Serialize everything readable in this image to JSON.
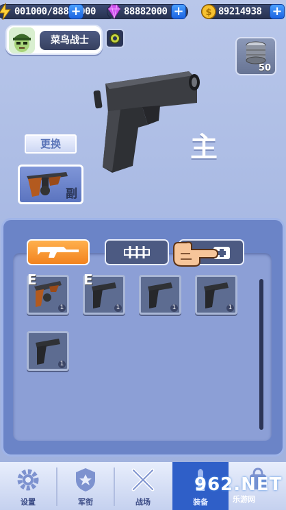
{
  "resources": {
    "energy": "001000/88887000",
    "gems": "88882000",
    "coins": "89214938"
  },
  "player": {
    "name": "菜鸟战士"
  },
  "ammo": {
    "count": "50"
  },
  "main_weapon": {
    "label": "主"
  },
  "swap_button": "更换",
  "secondary_weapon": {
    "tag": "副"
  },
  "inventory": {
    "tabs": [
      {
        "name": "rifle",
        "active": true
      },
      {
        "name": "ammo-belt",
        "active": false
      },
      {
        "name": "medkit",
        "active": false
      }
    ],
    "items": [
      {
        "kind": "tommy-gun",
        "qty": "1",
        "equipped_mark": "E"
      },
      {
        "kind": "pistol",
        "qty": "1",
        "equipped_mark": "E"
      },
      {
        "kind": "pistol",
        "qty": "1",
        "equipped_mark": ""
      },
      {
        "kind": "pistol",
        "qty": "1",
        "equipped_mark": ""
      },
      {
        "kind": "pistol",
        "qty": "1",
        "equipped_mark": ""
      }
    ]
  },
  "nav": {
    "settings": "设置",
    "rank": "军衔",
    "battle": "战场",
    "armory": "装备",
    "extra": ""
  },
  "watermark": {
    "main": "962.NET",
    "sub": "乐游网"
  },
  "colors": {
    "background": "#a8b9e3",
    "panel": "#6b84c7",
    "tab_active": "#f2831f",
    "nav_active": "#2f5fc8"
  }
}
